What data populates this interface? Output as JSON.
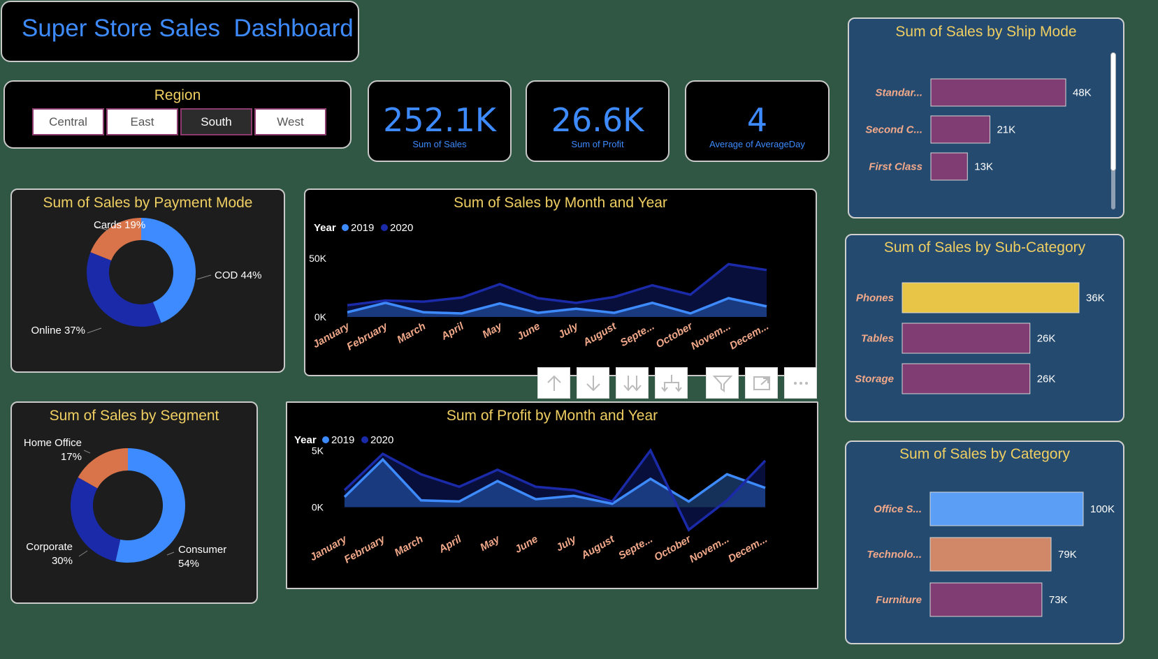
{
  "header": {
    "title": "Super Store Sales  Dashboard"
  },
  "region_slicer": {
    "title": "Region",
    "options": [
      "Central",
      "East",
      "South",
      "West"
    ],
    "selected": "South"
  },
  "kpis": [
    {
      "value": "252.1K",
      "label": "Sum of Sales"
    },
    {
      "value": "26.6K",
      "label": "Sum of Profit"
    },
    {
      "value": "4",
      "label": "Average of AverageDay"
    }
  ],
  "visual_toolbar": {
    "icons": [
      "arrow-up-icon",
      "arrow-down-icon",
      "double-arrow-down-icon",
      "expand-hierarchy-icon",
      "filter-icon",
      "focus-mode-icon",
      "more-options-icon"
    ]
  },
  "colors": {
    "background": "#2f5744",
    "title_gold": "#f0cf62",
    "accent_blue": "#3d8bff",
    "dark_blue": "#1a2aa8",
    "orange": "#d8734a",
    "purple": "#7f3d73",
    "yellow": "#e8c547",
    "light_blue": "#5a9ef5",
    "salmon": "#d08868"
  },
  "chart_data": [
    {
      "id": "payment_mode",
      "type": "pie",
      "title": "Sum of Sales by Payment Mode",
      "slices": [
        {
          "label": "COD",
          "percent": 44,
          "display": "COD 44%",
          "color": "#3d8bff"
        },
        {
          "label": "Online",
          "percent": 37,
          "display": "Online 37%",
          "color": "#1a2aa8"
        },
        {
          "label": "Cards",
          "percent": 19,
          "display": "Cards 19%",
          "color": "#d8734a"
        }
      ]
    },
    {
      "id": "segment",
      "type": "pie",
      "title": "Sum of Sales by Segment",
      "slices": [
        {
          "label": "Consumer",
          "percent": 54,
          "display": [
            "Consumer",
            "54%"
          ],
          "color": "#3d8bff"
        },
        {
          "label": "Corporate",
          "percent": 30,
          "display": [
            "Corporate",
            "30%"
          ],
          "color": "#1a2aa8"
        },
        {
          "label": "Home Office",
          "percent": 17,
          "display": [
            "Home Office",
            "17%"
          ],
          "color": "#d8734a"
        }
      ]
    },
    {
      "id": "sales_month",
      "type": "area",
      "title": "Sum of Sales by Month and Year",
      "legend_title": "Year",
      "categories": [
        "January",
        "February",
        "March",
        "April",
        "May",
        "June",
        "July",
        "August",
        "Septe...",
        "October",
        "Novem...",
        "Decem..."
      ],
      "yticks": [
        "50K",
        "0K"
      ],
      "ytick_values": [
        50000,
        0
      ],
      "ylim": [
        0,
        50000
      ],
      "series": [
        {
          "name": "2019",
          "color": "#3d8bff",
          "values": [
            4000,
            12000,
            4000,
            3000,
            11500,
            3500,
            7000,
            3500,
            12000,
            3000,
            16000,
            9000
          ]
        },
        {
          "name": "2020",
          "color": "#1a2aa8",
          "values": [
            10000,
            14000,
            13000,
            16500,
            28000,
            16000,
            12000,
            17000,
            27000,
            19000,
            45000,
            40000
          ]
        }
      ]
    },
    {
      "id": "profit_month",
      "type": "area",
      "title": "Sum of Profit by Month and Year",
      "legend_title": "Year",
      "categories": [
        "January",
        "February",
        "March",
        "April",
        "May",
        "June",
        "July",
        "August",
        "Septe...",
        "October",
        "Novem...",
        "Decem..."
      ],
      "yticks": [
        "5K",
        "0K"
      ],
      "ytick_values": [
        5000,
        0
      ],
      "ylim": [
        -2000,
        6000
      ],
      "series": [
        {
          "name": "2019",
          "color": "#3d8bff",
          "values": [
            900,
            4200,
            600,
            500,
            2300,
            700,
            1000,
            300,
            2500,
            500,
            2900,
            1700
          ]
        },
        {
          "name": "2020",
          "color": "#1a2aa8",
          "values": [
            1500,
            4700,
            2900,
            1800,
            3300,
            1800,
            1500,
            500,
            5000,
            -2000,
            600,
            4100
          ]
        }
      ]
    },
    {
      "id": "ship_mode",
      "type": "bar",
      "title": "Sum of Sales by Ship Mode",
      "categories": [
        "Standar...",
        "Second C...",
        "First Class"
      ],
      "values": [
        48000,
        21000,
        13000
      ],
      "value_labels": [
        "48K",
        "21K",
        "13K"
      ],
      "colors": [
        "#7f3d73",
        "#7f3d73",
        "#7f3d73"
      ],
      "xlim": [
        0,
        48000
      ]
    },
    {
      "id": "sub_category",
      "type": "bar",
      "title": "Sum of Sales by Sub-Category",
      "categories": [
        "Phones",
        "Tables",
        "Storage"
      ],
      "values": [
        36000,
        26000,
        26000
      ],
      "value_labels": [
        "36K",
        "26K",
        "26K"
      ],
      "colors": [
        "#e8c547",
        "#7f3d73",
        "#7f3d73"
      ],
      "xlim": [
        0,
        36000
      ]
    },
    {
      "id": "category",
      "type": "bar",
      "title": "Sum of Sales by Category",
      "categories": [
        "Office S...",
        "Technolo...",
        "Furniture"
      ],
      "values": [
        100000,
        79000,
        73000
      ],
      "value_labels": [
        "100K",
        "79K",
        "73K"
      ],
      "colors": [
        "#5a9ef5",
        "#d08868",
        "#7f3d73"
      ],
      "xlim": [
        0,
        100000
      ]
    }
  ]
}
